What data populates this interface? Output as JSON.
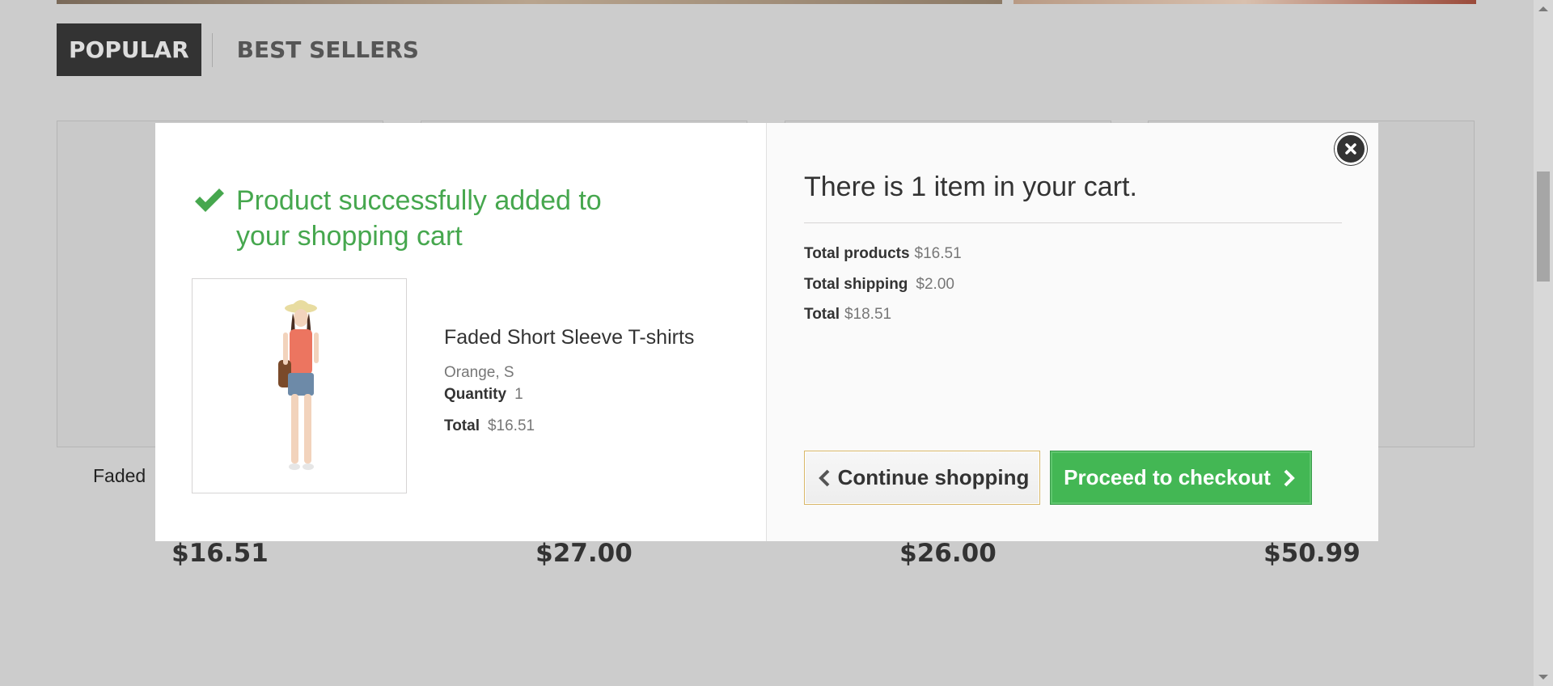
{
  "tabs": {
    "popular": "POPULAR",
    "best_sellers": "BEST SELLERS"
  },
  "products": [
    {
      "name": "Faded",
      "price": "$16.51"
    },
    {
      "price": "$27.00"
    },
    {
      "price": "$26.00"
    },
    {
      "price": "$50.99"
    }
  ],
  "modal": {
    "success_title": "Product successfully added to your shopping cart",
    "product": {
      "name": "Faded Short Sleeve T-shirts",
      "attributes": "Orange, S",
      "quantity_label": "Quantity",
      "quantity": "1",
      "total_label": "Total",
      "total": "$16.51"
    },
    "cart": {
      "title": "There is 1 item in your cart.",
      "total_products_label": "Total products",
      "total_products": "$16.51",
      "total_shipping_label": "Total shipping",
      "total_shipping": "$2.00",
      "total_label": "Total",
      "total": "$18.51"
    },
    "continue_label": "Continue shopping",
    "checkout_label": "Proceed to checkout"
  },
  "colors": {
    "success_green": "#46a74e",
    "checkout_green": "#43b754",
    "tab_active_bg": "#333333"
  },
  "icons": {
    "check": "check-icon",
    "close": "close-icon",
    "chevron_left": "chevron-left-icon",
    "chevron_right": "chevron-right-icon"
  }
}
